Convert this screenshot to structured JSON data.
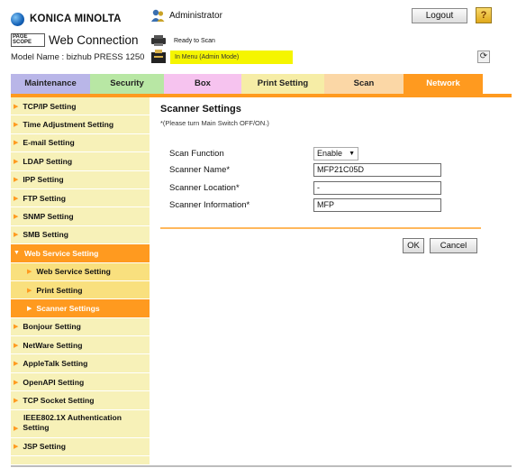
{
  "header": {
    "brand": "KONICA MINOLTA",
    "pagescope_badge": [
      "PAGE",
      "SCOPE"
    ],
    "app_title": "Web Connection",
    "model": "Model Name : bizhub PRESS 1250",
    "user": "Administrator",
    "status_ready": "Ready to Scan",
    "status_mode": "In Menu (Admin Mode)",
    "logout_label": "Logout",
    "help_label": "?",
    "refresh_label": "⟳"
  },
  "tabs": [
    "Maintenance",
    "Security",
    "Box",
    "Print Setting",
    "Scan",
    "Network"
  ],
  "active_tab": "Network",
  "sidebar": {
    "items": [
      {
        "label": "TCP/IP Setting"
      },
      {
        "label": "Time Adjustment Setting"
      },
      {
        "label": "E-mail Setting"
      },
      {
        "label": "LDAP Setting"
      },
      {
        "label": "IPP Setting"
      },
      {
        "label": "FTP Setting"
      },
      {
        "label": "SNMP Setting"
      },
      {
        "label": "SMB Setting"
      },
      {
        "label": "Web Service Setting"
      },
      {
        "label": "Web Service Setting"
      },
      {
        "label": "Print Setting"
      },
      {
        "label": "Scanner Settings"
      },
      {
        "label": "Bonjour Setting"
      },
      {
        "label": "NetWare Setting"
      },
      {
        "label": "AppleTalk Setting"
      },
      {
        "label": "OpenAPI Setting"
      },
      {
        "label": "TCP Socket Setting"
      },
      {
        "label_line1": "IEEE802.1X Authentication",
        "label_line2": "Setting"
      },
      {
        "label": "JSP Setting"
      }
    ]
  },
  "main": {
    "title": "Scanner Settings",
    "note": "*(Please turn Main Switch OFF/ON.)",
    "fields": {
      "scan_function": {
        "label": "Scan Function",
        "value": "Enable"
      },
      "scanner_name": {
        "label": "Scanner Name*",
        "value": "MFP21C05D"
      },
      "scanner_location": {
        "label": "Scanner Location*",
        "value": "-"
      },
      "scanner_information": {
        "label": "Scanner Information*",
        "value": "MFP"
      }
    },
    "ok_label": "OK",
    "cancel_label": "Cancel"
  },
  "colors": {
    "accent_orange": "#ff9a1f",
    "sidebar_bg": "#f7f1b8",
    "status_yellow": "#f5f500"
  }
}
